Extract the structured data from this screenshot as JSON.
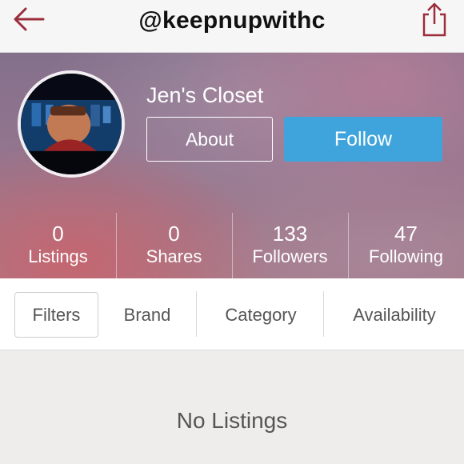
{
  "header": {
    "username": "@keepnupwithc"
  },
  "profile": {
    "name": "Jen's Closet",
    "about_label": "About",
    "follow_label": "Follow"
  },
  "stats": [
    {
      "count": "0",
      "label": "Listings"
    },
    {
      "count": "0",
      "label": "Shares"
    },
    {
      "count": "133",
      "label": "Followers"
    },
    {
      "count": "47",
      "label": "Following"
    }
  ],
  "filters": {
    "filters_label": "Filters",
    "brand_label": "Brand",
    "category_label": "Category",
    "availability_label": "Availability"
  },
  "content": {
    "empty_message": "No Listings"
  },
  "colors": {
    "accent_icon": "#9b2d3c",
    "follow_button": "#3fa4dc"
  }
}
